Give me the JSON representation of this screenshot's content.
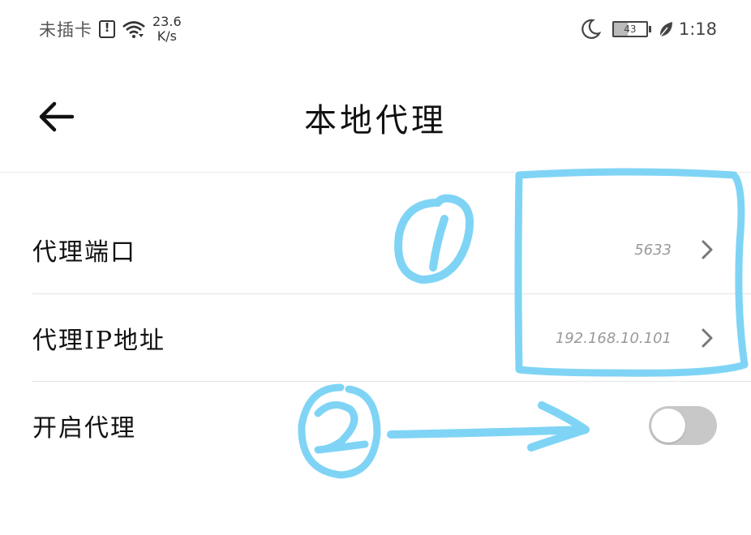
{
  "status_bar": {
    "carrier": "未插卡",
    "net_speed_value": "23.6",
    "net_speed_unit": "K/s",
    "battery_level": "43",
    "time": "1:18",
    "icons": [
      "sim-alert-icon",
      "wifi-icon",
      "moon-icon",
      "battery-icon",
      "leaf-icon"
    ]
  },
  "header": {
    "back_icon": "back-arrow-icon",
    "title": "本地代理"
  },
  "settings": [
    {
      "label": "代理端口",
      "value": "5633",
      "type": "link"
    },
    {
      "label": "代理IP地址",
      "value": "192.168.10.101",
      "type": "link"
    },
    {
      "label": "开启代理",
      "toggle_on": false,
      "type": "toggle"
    }
  ],
  "annotations": {
    "color": "#7fd4f5",
    "marks": [
      "1",
      "2"
    ]
  }
}
